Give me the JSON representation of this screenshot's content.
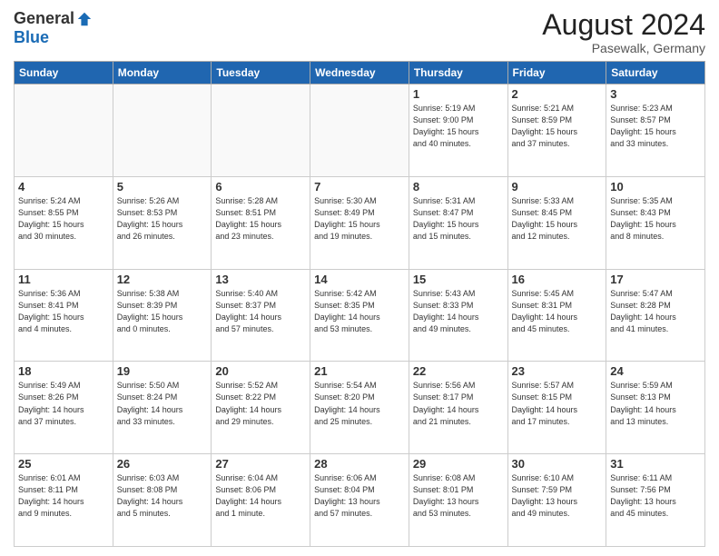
{
  "header": {
    "logo_general": "General",
    "logo_blue": "Blue",
    "main_title": "August 2024",
    "subtitle": "Pasewalk, Germany"
  },
  "weekdays": [
    "Sunday",
    "Monday",
    "Tuesday",
    "Wednesday",
    "Thursday",
    "Friday",
    "Saturday"
  ],
  "weeks": [
    [
      {
        "day": "",
        "info": ""
      },
      {
        "day": "",
        "info": ""
      },
      {
        "day": "",
        "info": ""
      },
      {
        "day": "",
        "info": ""
      },
      {
        "day": "1",
        "info": "Sunrise: 5:19 AM\nSunset: 9:00 PM\nDaylight: 15 hours\nand 40 minutes."
      },
      {
        "day": "2",
        "info": "Sunrise: 5:21 AM\nSunset: 8:59 PM\nDaylight: 15 hours\nand 37 minutes."
      },
      {
        "day": "3",
        "info": "Sunrise: 5:23 AM\nSunset: 8:57 PM\nDaylight: 15 hours\nand 33 minutes."
      }
    ],
    [
      {
        "day": "4",
        "info": "Sunrise: 5:24 AM\nSunset: 8:55 PM\nDaylight: 15 hours\nand 30 minutes."
      },
      {
        "day": "5",
        "info": "Sunrise: 5:26 AM\nSunset: 8:53 PM\nDaylight: 15 hours\nand 26 minutes."
      },
      {
        "day": "6",
        "info": "Sunrise: 5:28 AM\nSunset: 8:51 PM\nDaylight: 15 hours\nand 23 minutes."
      },
      {
        "day": "7",
        "info": "Sunrise: 5:30 AM\nSunset: 8:49 PM\nDaylight: 15 hours\nand 19 minutes."
      },
      {
        "day": "8",
        "info": "Sunrise: 5:31 AM\nSunset: 8:47 PM\nDaylight: 15 hours\nand 15 minutes."
      },
      {
        "day": "9",
        "info": "Sunrise: 5:33 AM\nSunset: 8:45 PM\nDaylight: 15 hours\nand 12 minutes."
      },
      {
        "day": "10",
        "info": "Sunrise: 5:35 AM\nSunset: 8:43 PM\nDaylight: 15 hours\nand 8 minutes."
      }
    ],
    [
      {
        "day": "11",
        "info": "Sunrise: 5:36 AM\nSunset: 8:41 PM\nDaylight: 15 hours\nand 4 minutes."
      },
      {
        "day": "12",
        "info": "Sunrise: 5:38 AM\nSunset: 8:39 PM\nDaylight: 15 hours\nand 0 minutes."
      },
      {
        "day": "13",
        "info": "Sunrise: 5:40 AM\nSunset: 8:37 PM\nDaylight: 14 hours\nand 57 minutes."
      },
      {
        "day": "14",
        "info": "Sunrise: 5:42 AM\nSunset: 8:35 PM\nDaylight: 14 hours\nand 53 minutes."
      },
      {
        "day": "15",
        "info": "Sunrise: 5:43 AM\nSunset: 8:33 PM\nDaylight: 14 hours\nand 49 minutes."
      },
      {
        "day": "16",
        "info": "Sunrise: 5:45 AM\nSunset: 8:31 PM\nDaylight: 14 hours\nand 45 minutes."
      },
      {
        "day": "17",
        "info": "Sunrise: 5:47 AM\nSunset: 8:28 PM\nDaylight: 14 hours\nand 41 minutes."
      }
    ],
    [
      {
        "day": "18",
        "info": "Sunrise: 5:49 AM\nSunset: 8:26 PM\nDaylight: 14 hours\nand 37 minutes."
      },
      {
        "day": "19",
        "info": "Sunrise: 5:50 AM\nSunset: 8:24 PM\nDaylight: 14 hours\nand 33 minutes."
      },
      {
        "day": "20",
        "info": "Sunrise: 5:52 AM\nSunset: 8:22 PM\nDaylight: 14 hours\nand 29 minutes."
      },
      {
        "day": "21",
        "info": "Sunrise: 5:54 AM\nSunset: 8:20 PM\nDaylight: 14 hours\nand 25 minutes."
      },
      {
        "day": "22",
        "info": "Sunrise: 5:56 AM\nSunset: 8:17 PM\nDaylight: 14 hours\nand 21 minutes."
      },
      {
        "day": "23",
        "info": "Sunrise: 5:57 AM\nSunset: 8:15 PM\nDaylight: 14 hours\nand 17 minutes."
      },
      {
        "day": "24",
        "info": "Sunrise: 5:59 AM\nSunset: 8:13 PM\nDaylight: 14 hours\nand 13 minutes."
      }
    ],
    [
      {
        "day": "25",
        "info": "Sunrise: 6:01 AM\nSunset: 8:11 PM\nDaylight: 14 hours\nand 9 minutes."
      },
      {
        "day": "26",
        "info": "Sunrise: 6:03 AM\nSunset: 8:08 PM\nDaylight: 14 hours\nand 5 minutes."
      },
      {
        "day": "27",
        "info": "Sunrise: 6:04 AM\nSunset: 8:06 PM\nDaylight: 14 hours\nand 1 minute."
      },
      {
        "day": "28",
        "info": "Sunrise: 6:06 AM\nSunset: 8:04 PM\nDaylight: 13 hours\nand 57 minutes."
      },
      {
        "day": "29",
        "info": "Sunrise: 6:08 AM\nSunset: 8:01 PM\nDaylight: 13 hours\nand 53 minutes."
      },
      {
        "day": "30",
        "info": "Sunrise: 6:10 AM\nSunset: 7:59 PM\nDaylight: 13 hours\nand 49 minutes."
      },
      {
        "day": "31",
        "info": "Sunrise: 6:11 AM\nSunset: 7:56 PM\nDaylight: 13 hours\nand 45 minutes."
      }
    ]
  ]
}
